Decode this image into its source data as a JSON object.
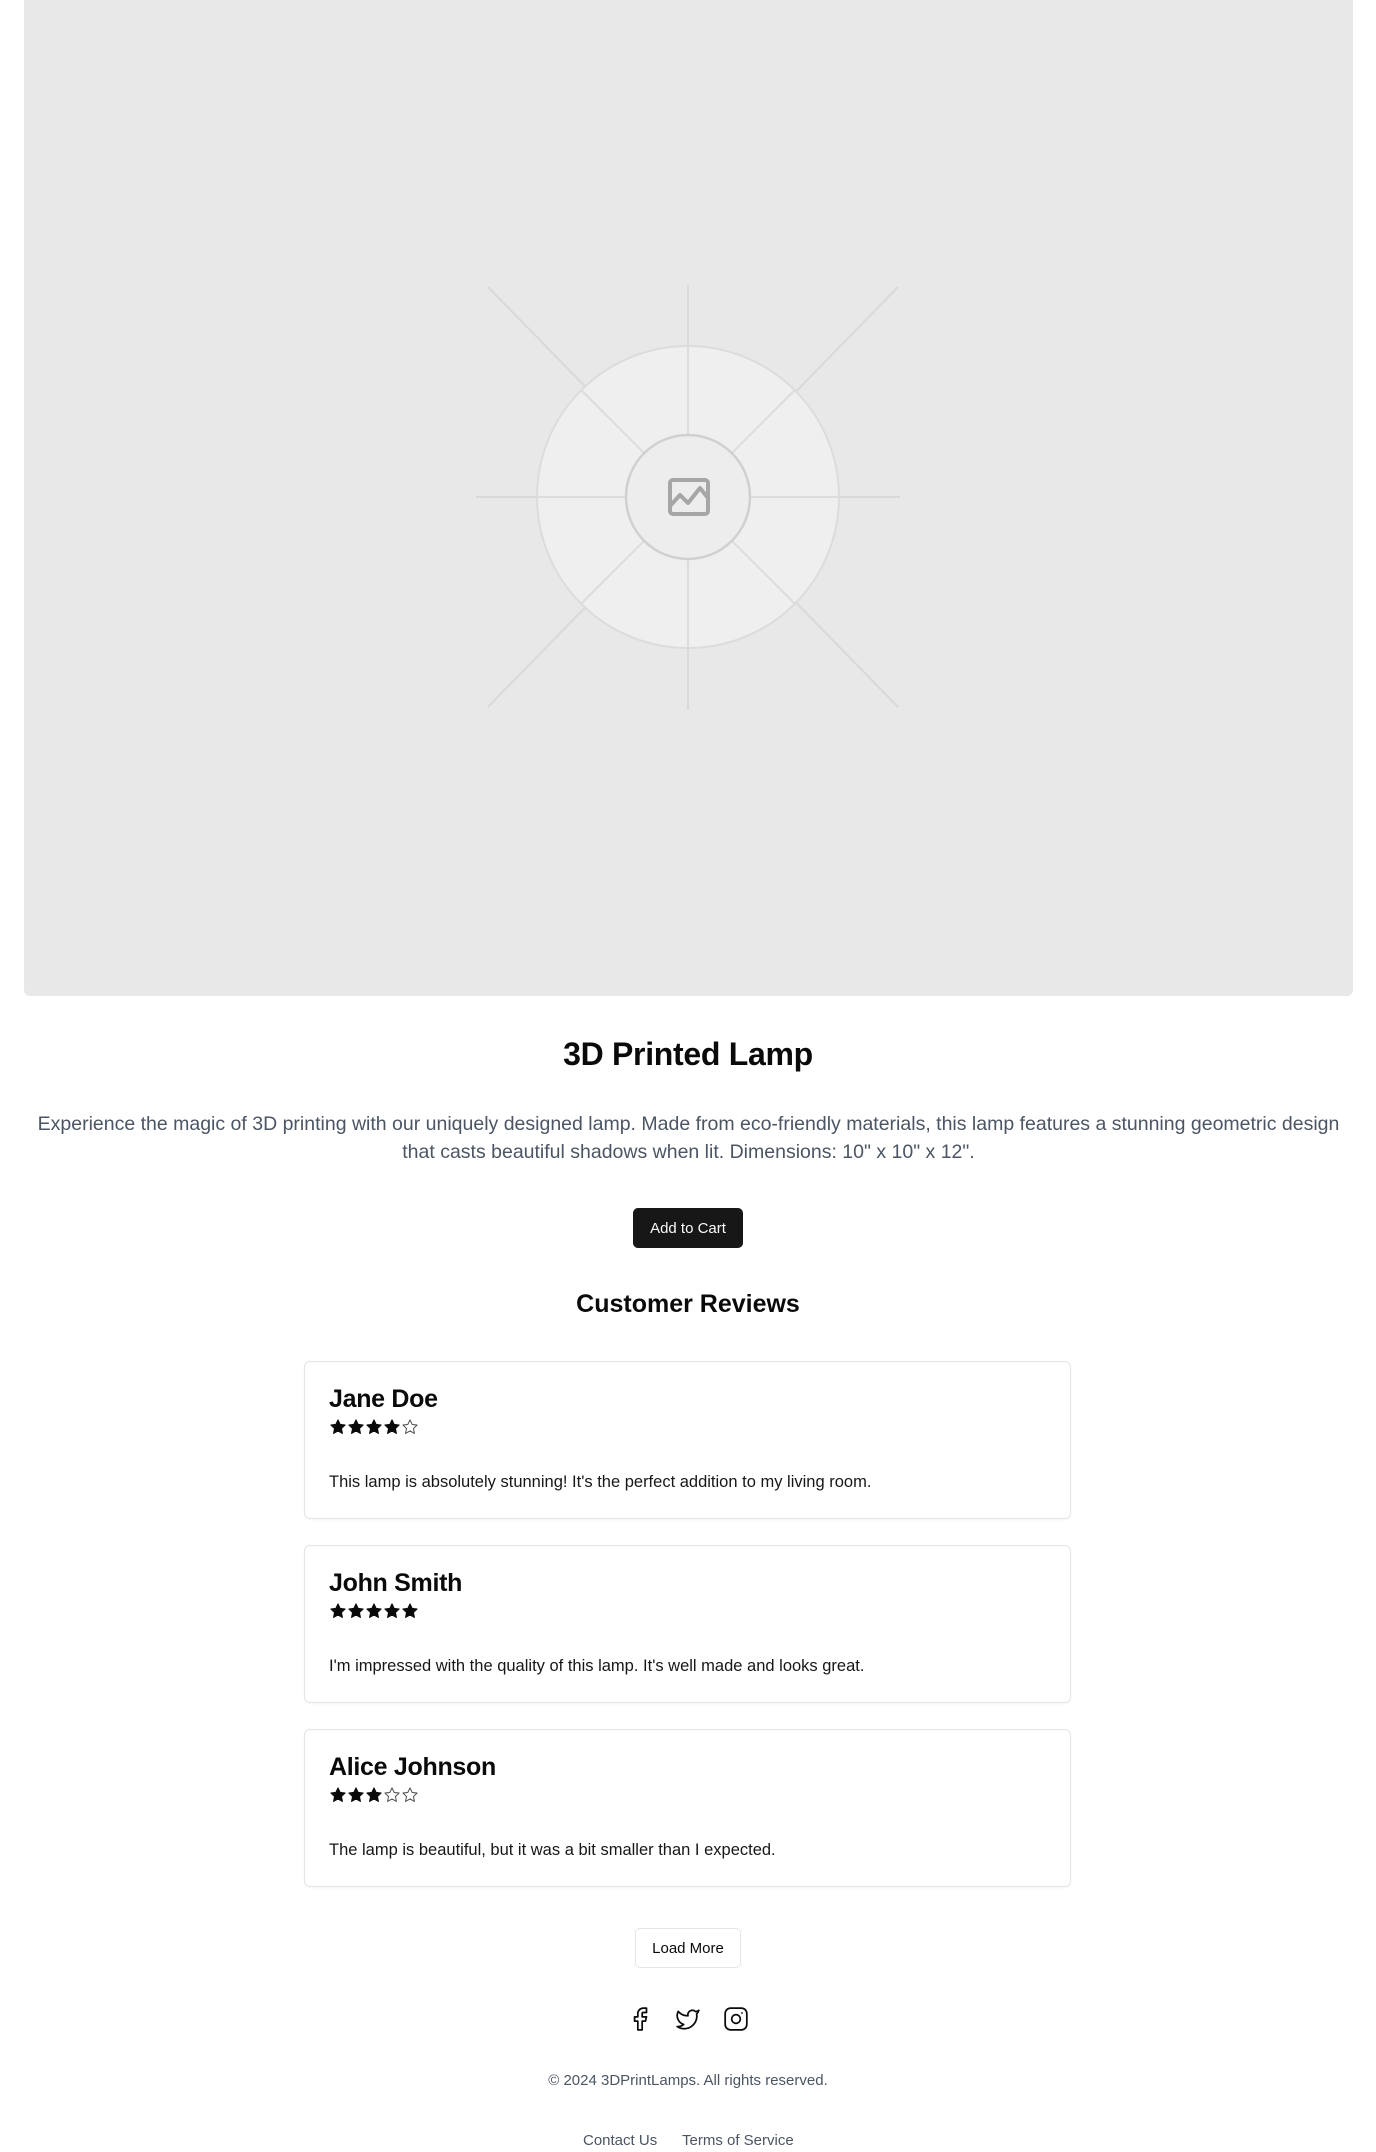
{
  "product": {
    "title": "3D Printed Lamp",
    "description": "Experience the magic of 3D printing with our uniquely designed lamp. Made from eco-friendly materials, this lamp features a stunning geometric design that casts beautiful shadows when lit. Dimensions: 10\" x 10\" x 12\".",
    "add_to_cart_label": "Add to Cart",
    "image_icon": "image-placeholder-icon"
  },
  "reviews": {
    "heading": "Customer Reviews",
    "items": [
      {
        "name": "Jane Doe",
        "rating": 4,
        "max_rating": 5,
        "text": "This lamp is absolutely stunning! It's the perfect addition to my living room."
      },
      {
        "name": "John Smith",
        "rating": 5,
        "max_rating": 5,
        "text": "I'm impressed with the quality of this lamp. It's well made and looks great."
      },
      {
        "name": "Alice Johnson",
        "rating": 3,
        "max_rating": 5,
        "text": "The lamp is beautiful, but it was a bit smaller than I expected."
      }
    ],
    "load_more_label": "Load More"
  },
  "footer": {
    "social_icons": [
      "facebook-icon",
      "twitter-icon",
      "instagram-icon"
    ],
    "copyright": "© 2024 3DPrintLamps. All rights reserved.",
    "links": [
      "Contact Us",
      "Terms of Service"
    ]
  },
  "colors": {
    "primary_button": "#171717",
    "placeholder_bg": "#e8e8e8",
    "muted_text": "#4b5563",
    "border": "#e5e5e5"
  }
}
